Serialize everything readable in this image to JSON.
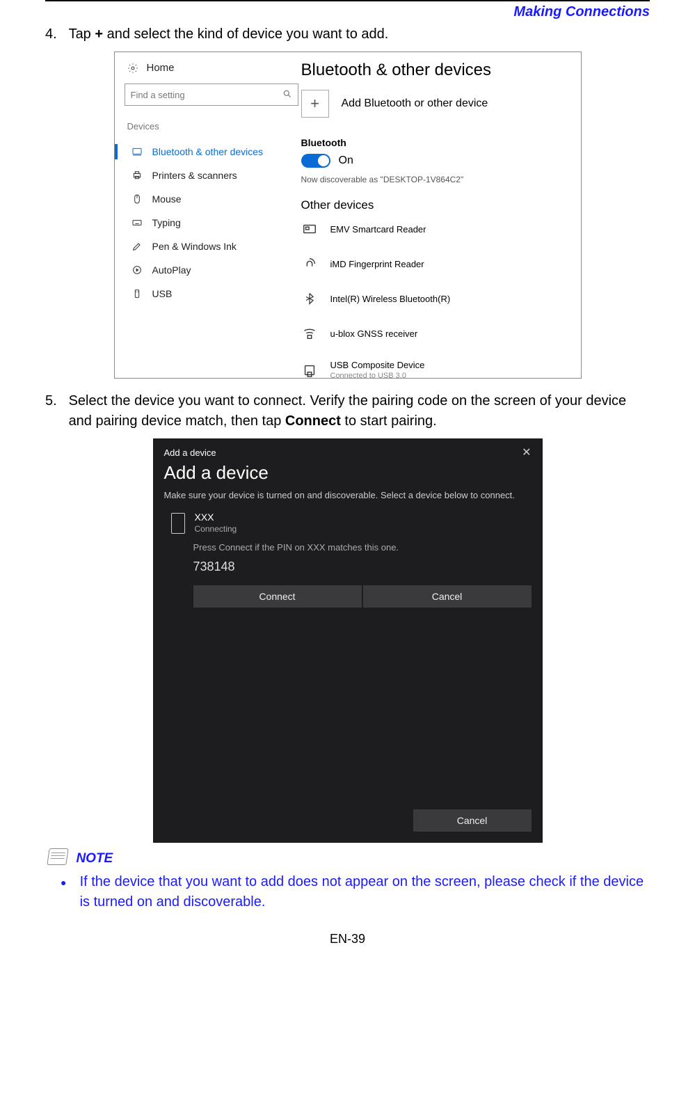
{
  "header": "Making Connections",
  "step4": {
    "num": "4.",
    "pre": "Tap ",
    "plus": "+",
    "post": " and select the kind of device you want to add."
  },
  "shot1": {
    "home": "Home",
    "search_placeholder": "Find a setting",
    "section": "Devices",
    "nav": [
      "Bluetooth & other devices",
      "Printers & scanners",
      "Mouse",
      "Typing",
      "Pen & Windows Ink",
      "AutoPlay",
      "USB"
    ],
    "title": "Bluetooth & other devices",
    "add_label": "Add Bluetooth or other device",
    "bt_head": "Bluetooth",
    "bt_state": "On",
    "discover": "Now discoverable as \"DESKTOP-1V864C2\"",
    "other_title": "Other devices",
    "devices": [
      {
        "name": "EMV Smartcard Reader",
        "sub": ""
      },
      {
        "name": "iMD Fingerprint Reader",
        "sub": ""
      },
      {
        "name": "Intel(R) Wireless Bluetooth(R)",
        "sub": ""
      },
      {
        "name": "u-blox GNSS receiver",
        "sub": ""
      },
      {
        "name": "USB Composite Device",
        "sub": "Connected to USB 3.0"
      }
    ]
  },
  "step5": {
    "num": "5.",
    "pre": "Select the device you want to connect. Verify the pairing code on the screen of your device and pairing device match, then tap ",
    "bold": "Connect",
    "post": " to start pairing."
  },
  "shot2": {
    "top": "Add a device",
    "title": "Add a device",
    "desc": "Make sure your device is turned on and discoverable. Select a device below to connect.",
    "device_name": "XXX",
    "device_status": "Connecting",
    "pin_msg": "Press Connect if the PIN on XXX matches this one.",
    "pin": "738148",
    "btn_connect": "Connect",
    "btn_cancel": "Cancel",
    "footer_cancel": "Cancel"
  },
  "note": {
    "label": "NOTE",
    "bullet": "If the device that you want to add does not appear on the screen, please check if the device is turned on and discoverable."
  },
  "page_num": "EN-39"
}
